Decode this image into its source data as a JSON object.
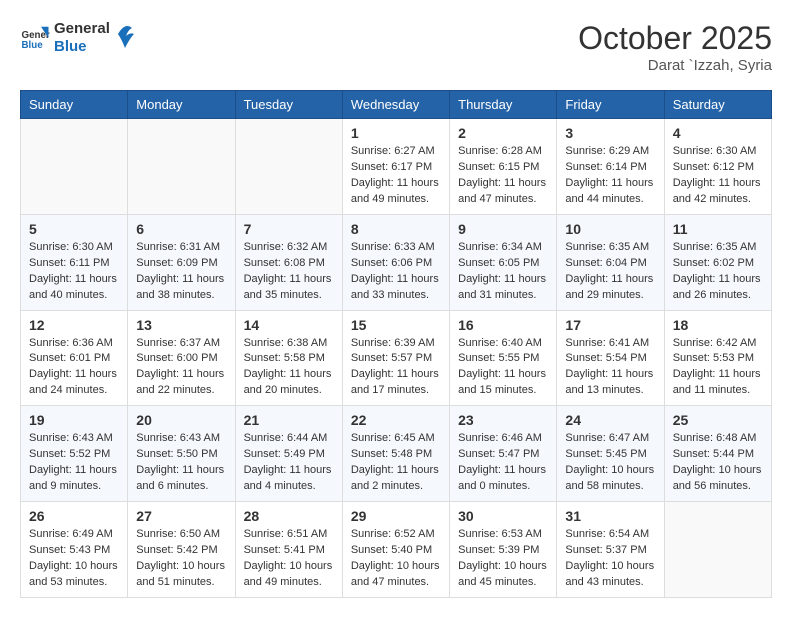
{
  "header": {
    "logo_general": "General",
    "logo_blue": "Blue",
    "month_title": "October 2025",
    "location": "Darat `Izzah, Syria"
  },
  "weekdays": [
    "Sunday",
    "Monday",
    "Tuesday",
    "Wednesday",
    "Thursday",
    "Friday",
    "Saturday"
  ],
  "weeks": [
    [
      {
        "day": "",
        "info": ""
      },
      {
        "day": "",
        "info": ""
      },
      {
        "day": "",
        "info": ""
      },
      {
        "day": "1",
        "info": "Sunrise: 6:27 AM\nSunset: 6:17 PM\nDaylight: 11 hours\nand 49 minutes."
      },
      {
        "day": "2",
        "info": "Sunrise: 6:28 AM\nSunset: 6:15 PM\nDaylight: 11 hours\nand 47 minutes."
      },
      {
        "day": "3",
        "info": "Sunrise: 6:29 AM\nSunset: 6:14 PM\nDaylight: 11 hours\nand 44 minutes."
      },
      {
        "day": "4",
        "info": "Sunrise: 6:30 AM\nSunset: 6:12 PM\nDaylight: 11 hours\nand 42 minutes."
      }
    ],
    [
      {
        "day": "5",
        "info": "Sunrise: 6:30 AM\nSunset: 6:11 PM\nDaylight: 11 hours\nand 40 minutes."
      },
      {
        "day": "6",
        "info": "Sunrise: 6:31 AM\nSunset: 6:09 PM\nDaylight: 11 hours\nand 38 minutes."
      },
      {
        "day": "7",
        "info": "Sunrise: 6:32 AM\nSunset: 6:08 PM\nDaylight: 11 hours\nand 35 minutes."
      },
      {
        "day": "8",
        "info": "Sunrise: 6:33 AM\nSunset: 6:06 PM\nDaylight: 11 hours\nand 33 minutes."
      },
      {
        "day": "9",
        "info": "Sunrise: 6:34 AM\nSunset: 6:05 PM\nDaylight: 11 hours\nand 31 minutes."
      },
      {
        "day": "10",
        "info": "Sunrise: 6:35 AM\nSunset: 6:04 PM\nDaylight: 11 hours\nand 29 minutes."
      },
      {
        "day": "11",
        "info": "Sunrise: 6:35 AM\nSunset: 6:02 PM\nDaylight: 11 hours\nand 26 minutes."
      }
    ],
    [
      {
        "day": "12",
        "info": "Sunrise: 6:36 AM\nSunset: 6:01 PM\nDaylight: 11 hours\nand 24 minutes."
      },
      {
        "day": "13",
        "info": "Sunrise: 6:37 AM\nSunset: 6:00 PM\nDaylight: 11 hours\nand 22 minutes."
      },
      {
        "day": "14",
        "info": "Sunrise: 6:38 AM\nSunset: 5:58 PM\nDaylight: 11 hours\nand 20 minutes."
      },
      {
        "day": "15",
        "info": "Sunrise: 6:39 AM\nSunset: 5:57 PM\nDaylight: 11 hours\nand 17 minutes."
      },
      {
        "day": "16",
        "info": "Sunrise: 6:40 AM\nSunset: 5:55 PM\nDaylight: 11 hours\nand 15 minutes."
      },
      {
        "day": "17",
        "info": "Sunrise: 6:41 AM\nSunset: 5:54 PM\nDaylight: 11 hours\nand 13 minutes."
      },
      {
        "day": "18",
        "info": "Sunrise: 6:42 AM\nSunset: 5:53 PM\nDaylight: 11 hours\nand 11 minutes."
      }
    ],
    [
      {
        "day": "19",
        "info": "Sunrise: 6:43 AM\nSunset: 5:52 PM\nDaylight: 11 hours\nand 9 minutes."
      },
      {
        "day": "20",
        "info": "Sunrise: 6:43 AM\nSunset: 5:50 PM\nDaylight: 11 hours\nand 6 minutes."
      },
      {
        "day": "21",
        "info": "Sunrise: 6:44 AM\nSunset: 5:49 PM\nDaylight: 11 hours\nand 4 minutes."
      },
      {
        "day": "22",
        "info": "Sunrise: 6:45 AM\nSunset: 5:48 PM\nDaylight: 11 hours\nand 2 minutes."
      },
      {
        "day": "23",
        "info": "Sunrise: 6:46 AM\nSunset: 5:47 PM\nDaylight: 11 hours\nand 0 minutes."
      },
      {
        "day": "24",
        "info": "Sunrise: 6:47 AM\nSunset: 5:45 PM\nDaylight: 10 hours\nand 58 minutes."
      },
      {
        "day": "25",
        "info": "Sunrise: 6:48 AM\nSunset: 5:44 PM\nDaylight: 10 hours\nand 56 minutes."
      }
    ],
    [
      {
        "day": "26",
        "info": "Sunrise: 6:49 AM\nSunset: 5:43 PM\nDaylight: 10 hours\nand 53 minutes."
      },
      {
        "day": "27",
        "info": "Sunrise: 6:50 AM\nSunset: 5:42 PM\nDaylight: 10 hours\nand 51 minutes."
      },
      {
        "day": "28",
        "info": "Sunrise: 6:51 AM\nSunset: 5:41 PM\nDaylight: 10 hours\nand 49 minutes."
      },
      {
        "day": "29",
        "info": "Sunrise: 6:52 AM\nSunset: 5:40 PM\nDaylight: 10 hours\nand 47 minutes."
      },
      {
        "day": "30",
        "info": "Sunrise: 6:53 AM\nSunset: 5:39 PM\nDaylight: 10 hours\nand 45 minutes."
      },
      {
        "day": "31",
        "info": "Sunrise: 6:54 AM\nSunset: 5:37 PM\nDaylight: 10 hours\nand 43 minutes."
      },
      {
        "day": "",
        "info": ""
      }
    ]
  ]
}
